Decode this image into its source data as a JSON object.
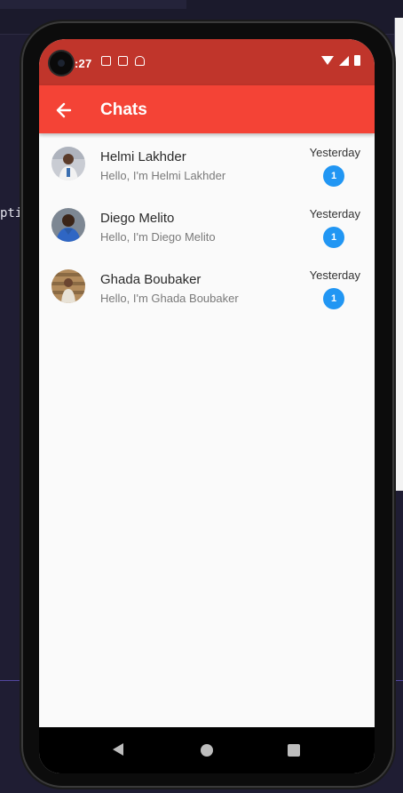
{
  "background": {
    "code_fragment": "pti"
  },
  "status_bar": {
    "time": ":27",
    "icons": [
      "notification-a-icon",
      "sd-card-icon",
      "android-debug-icon"
    ],
    "right_icons": [
      "wifi-icon",
      "signal-icon",
      "battery-icon"
    ]
  },
  "app_bar": {
    "title": "Chats",
    "back_icon": "arrow-left-icon",
    "color": "#f44336"
  },
  "chats": [
    {
      "name": "Helmi Lakhder",
      "message": "Hello, I'm Helmi Lakhder",
      "time": "Yesterday",
      "unread": "1"
    },
    {
      "name": "Diego Melito",
      "message": "Hello, I'm Diego Melito",
      "time": "Yesterday",
      "unread": "1"
    },
    {
      "name": "Ghada Boubaker",
      "message": "Hello, I'm Ghada Boubaker",
      "time": "Yesterday",
      "unread": "1"
    }
  ],
  "colors": {
    "status_bar": "#c0352b",
    "badge": "#2196f3",
    "list_background": "#fafafa"
  },
  "nav_bar": {
    "icons": [
      "back-triangle-icon",
      "home-circle-icon",
      "recents-square-icon"
    ]
  }
}
